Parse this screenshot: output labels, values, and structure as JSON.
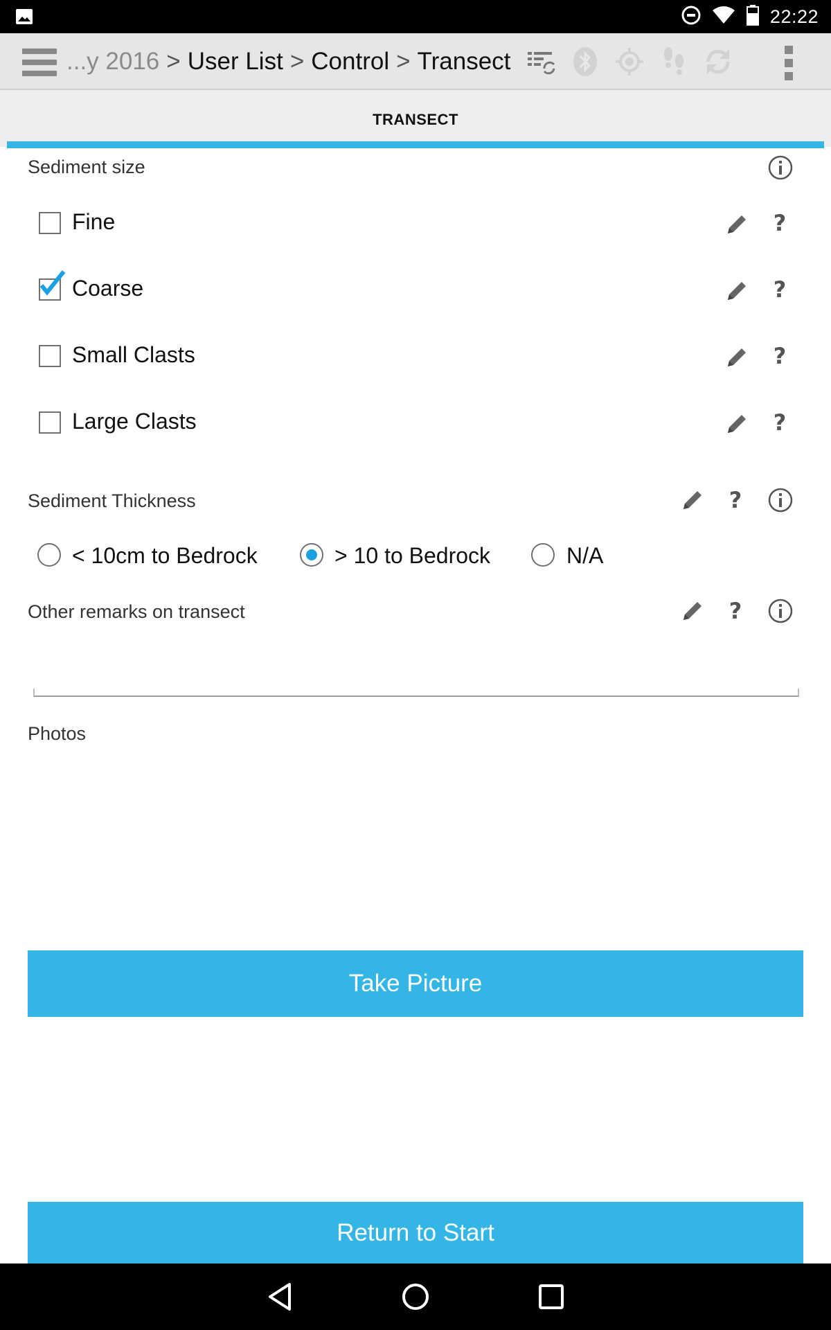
{
  "status_bar": {
    "clock": "22:22",
    "left_icon": "image-notification-icon",
    "right_icons": [
      "do-not-disturb-icon",
      "wifi-icon",
      "battery-icon"
    ]
  },
  "action_bar": {
    "breadcrumb": {
      "truncated": "...y 2016",
      "sep1": ">",
      "item1": "User List",
      "sep2": ">",
      "item2": "Control",
      "sep3": ">",
      "item3": "Transect"
    },
    "icons": [
      "sync-list-icon",
      "bluetooth-icon",
      "gps-target-icon",
      "footprints-icon",
      "refresh-icon"
    ]
  },
  "tab": {
    "label": "TRANSECT",
    "accent": "#33b5e5"
  },
  "sediment_size": {
    "label": "Sediment size",
    "options": [
      {
        "label": "Fine",
        "checked": false
      },
      {
        "label": "Coarse",
        "checked": true
      },
      {
        "label": "Small Clasts",
        "checked": false
      },
      {
        "label": "Large Clasts",
        "checked": false
      }
    ]
  },
  "sediment_thickness": {
    "label": "Sediment Thickness",
    "options": [
      {
        "label": "< 10cm to Bedrock",
        "selected": false
      },
      {
        "label": "> 10 to Bedrock",
        "selected": true
      },
      {
        "label": "N/A",
        "selected": false
      }
    ]
  },
  "remarks": {
    "label": "Other remarks on transect",
    "value": ""
  },
  "photos": {
    "label": "Photos"
  },
  "buttons": {
    "take_picture": "Take Picture",
    "return_to_start": "Return to Start"
  },
  "help_glyph": "?"
}
